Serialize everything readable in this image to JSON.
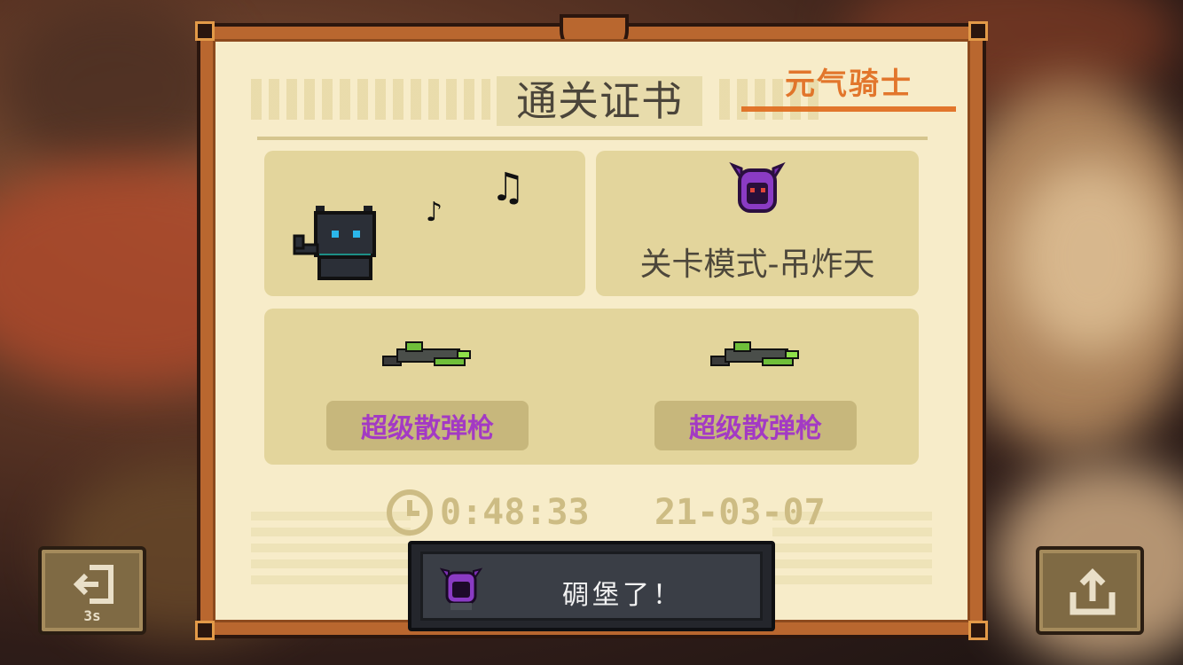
{
  "certificate": {
    "title": "通关证书",
    "stamp_text": "元气骑士",
    "level_name": "关卡模式-吊炸天",
    "weapons": [
      {
        "name": "超级散弹枪",
        "icon": "shotgun-icon"
      },
      {
        "name": "超级散弹枪",
        "icon": "shotgun-icon"
      }
    ],
    "time": "0:48:33",
    "date": "21-03-07"
  },
  "exit_button": {
    "countdown": "3s",
    "icon": "exit-icon"
  },
  "share_button": {
    "icon": "share-icon"
  },
  "toast": {
    "message": "碉堡了！",
    "icon": "demon-helmet-icon"
  },
  "colors": {
    "frame": "#b9672f",
    "paper": "#f7ecc9",
    "panel": "#e3d59c",
    "weapon_text": "#a33ac4",
    "stamp": "#e06a1c"
  }
}
